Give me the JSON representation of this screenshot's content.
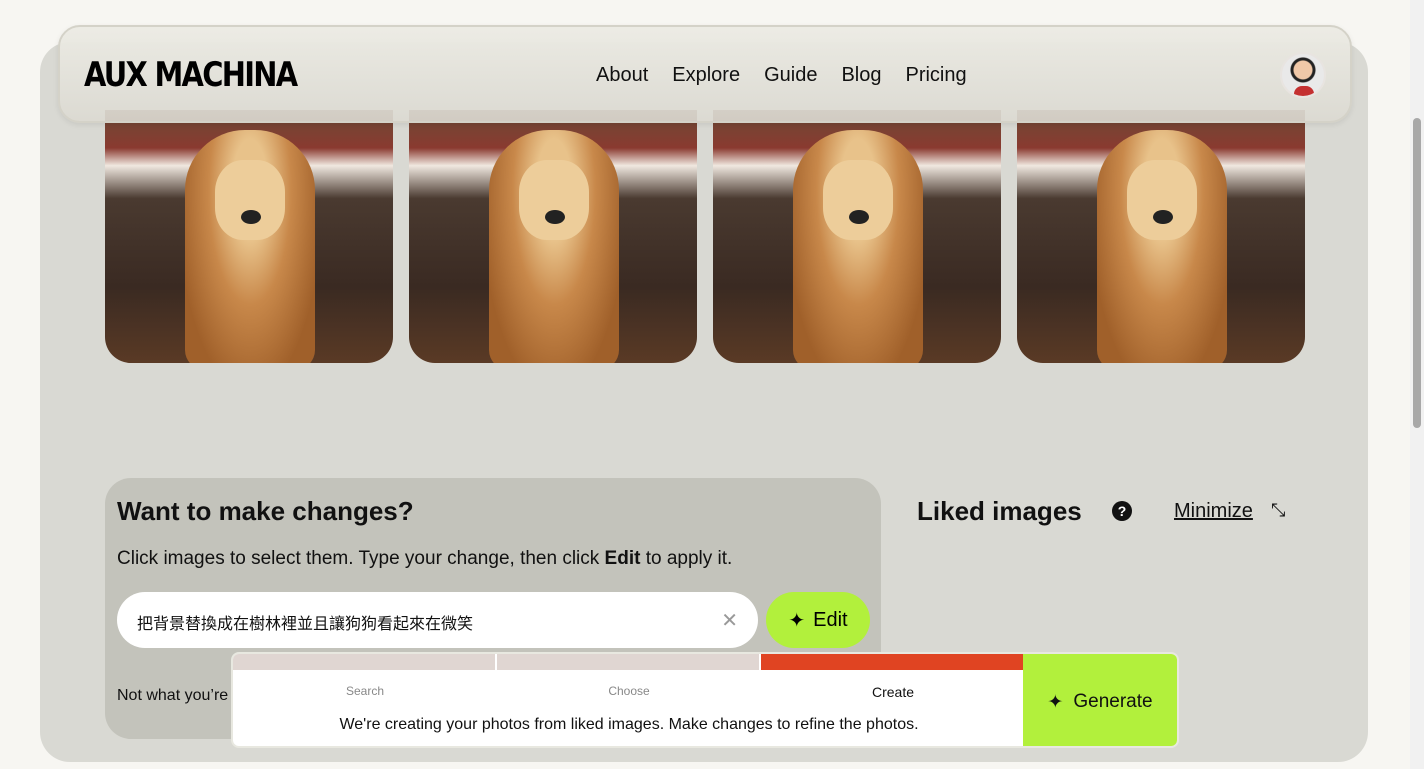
{
  "header": {
    "logo": "AUX MACHINA",
    "nav": [
      "About",
      "Explore",
      "Guide",
      "Blog",
      "Pricing"
    ]
  },
  "images": [
    "generated-dog-1",
    "generated-dog-2",
    "generated-dog-3",
    "generated-dog-4"
  ],
  "changes": {
    "title": "Want to make changes?",
    "instruction_pre": "Click images to select them. Type your change, then click ",
    "instruction_bold": "Edit",
    "instruction_post": " to apply it.",
    "input_value": "把背景替換成在樹林裡並且讓狗狗看起來在微笑",
    "edit_label": "Edit",
    "not_what": "Not what you’re"
  },
  "liked": {
    "title": "Liked images",
    "help": "?",
    "minimize": "Minimize"
  },
  "progress": {
    "steps": [
      "Search",
      "Choose",
      "Create"
    ],
    "active_step": "Create",
    "message": "We're creating your photos from liked images. Make changes to refine the photos.",
    "generate_label": "Generate"
  },
  "colors": {
    "accent": "#b2f03c",
    "active_step": "#e04422",
    "inactive_step": "#e0d6d2"
  }
}
